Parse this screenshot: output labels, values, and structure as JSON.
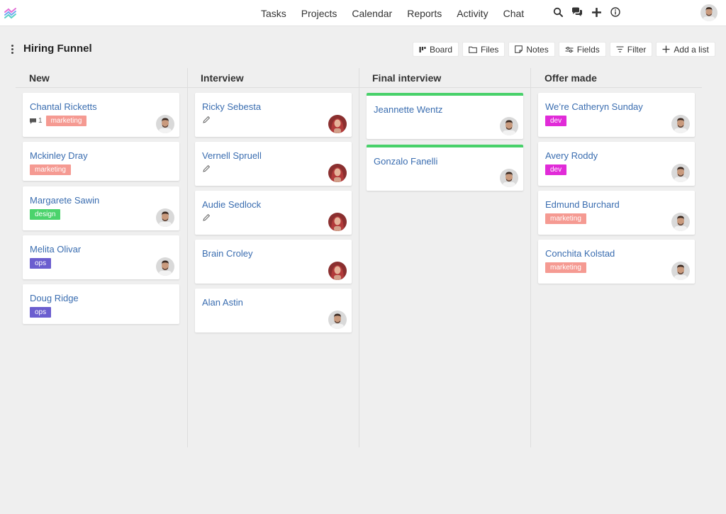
{
  "nav": {
    "items": [
      "Tasks",
      "Projects",
      "Calendar",
      "Reports",
      "Activity",
      "Chat"
    ]
  },
  "header": {
    "title": "Hiring Funnel",
    "toolbar": {
      "board": "Board",
      "files": "Files",
      "notes": "Notes",
      "fields": "Fields",
      "filter": "Filter",
      "add_list": "Add a list"
    }
  },
  "colors": {
    "marketing": "#f59a92",
    "design": "#4bd36c",
    "ops": "#6b5ecf",
    "dev": "#e12bd8",
    "link": "#3a6db0",
    "accent_green": "#48d16a"
  },
  "columns": [
    {
      "title": "New",
      "cards": [
        {
          "name": "Chantal Ricketts",
          "comments": "1",
          "tag": "marketing",
          "avatar": "male"
        },
        {
          "name": "Mckinley Dray",
          "tag": "marketing"
        },
        {
          "name": "Margarete Sawin",
          "tag": "design",
          "avatar": "male"
        },
        {
          "name": "Melita Olivar",
          "tag": "ops",
          "avatar": "male"
        },
        {
          "name": "Doug Ridge",
          "tag": "ops"
        }
      ]
    },
    {
      "title": "Interview",
      "cards": [
        {
          "name": "Ricky Sebesta",
          "icon": "pencil-icon",
          "avatar": "female"
        },
        {
          "name": "Vernell Spruell",
          "icon": "pencil-icon",
          "avatar": "female"
        },
        {
          "name": "Audie Sedlock",
          "icon": "pencil-icon",
          "avatar": "female"
        },
        {
          "name": "Brain Croley",
          "avatar": "female"
        },
        {
          "name": "Alan Astin",
          "avatar": "male"
        }
      ]
    },
    {
      "title": "Final interview",
      "cards": [
        {
          "name": "Jeannette Wentz",
          "avatar": "male"
        },
        {
          "name": "Gonzalo Fanelli",
          "avatar": "male"
        }
      ]
    },
    {
      "title": "Offer made",
      "cards": [
        {
          "name": "We’re Catheryn Sunday",
          "tag": "dev",
          "avatar": "male"
        },
        {
          "name": "Avery Roddy",
          "tag": "dev",
          "avatar": "male"
        },
        {
          "name": "Edmund Burchard",
          "tag": "marketing",
          "avatar": "male"
        },
        {
          "name": "Conchita Kolstad",
          "tag": "marketing",
          "avatar": "male"
        }
      ]
    }
  ]
}
